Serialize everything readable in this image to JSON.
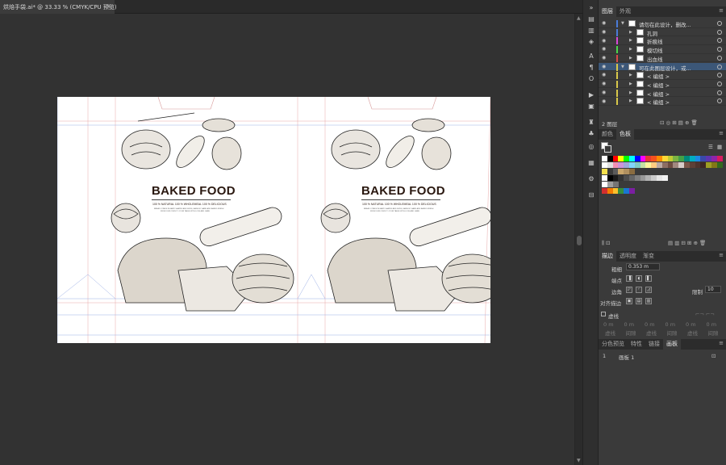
{
  "document_tab": {
    "title": "烘焙手袋.ai* @ 33.33 % (CMYK/CPU 预览)",
    "close_glyph": "×"
  },
  "artwork": {
    "left_panel": {
      "title": "BAKED FOOD",
      "subtitle": "100 % NATURAL  100 % WHOLEMEAL  100 % DELICIOUS",
      "fine_print_1": "BREAD COMES IN MANY SHAPES AND SIZES, MADE BY HAND AND BAKED FRESH",
      "fine_print_2": "FROM OUR OVEN TO YOUR TABLE WITH LOVE AND CARE"
    },
    "right_panel": {
      "title": "BAKED FOOD",
      "subtitle": "100 % NATURAL  100 % WHOLEMEAL  100 % DELICIOUS",
      "fine_print_1": "BREAD COMES IN MANY SHAPES AND SIZES, MADE BY HAND AND BAKED FRESH",
      "fine_print_2": "FROM OUR OVEN TO YOUR TABLE WITH LOVE AND CARE"
    }
  },
  "layers_panel": {
    "tabs": [
      "图层",
      "外观"
    ],
    "active_tab": "图层",
    "rows": [
      {
        "name": "请勿在此设计，删改...",
        "color": "#4a7bd8",
        "level": 0,
        "expanded": true,
        "selected": false
      },
      {
        "name": "孔洞",
        "color": "#4a7bd8",
        "level": 1,
        "expanded": false,
        "selected": false
      },
      {
        "name": "折痕线",
        "color": "#d84ad8",
        "level": 1,
        "expanded": false,
        "selected": false
      },
      {
        "name": "模切线",
        "color": "#4ad84a",
        "level": 1,
        "expanded": false,
        "selected": false
      },
      {
        "name": "出血线",
        "color": "#d84a4a",
        "level": 1,
        "expanded": false,
        "selected": false
      },
      {
        "name": "可在此图层设计，或...",
        "color": "#d8c84a",
        "level": 0,
        "expanded": true,
        "selected": true
      },
      {
        "name": "< 编组 >",
        "color": "#d8c84a",
        "level": 1,
        "expanded": false,
        "selected": false
      },
      {
        "name": "< 编组 >",
        "color": "#d8c84a",
        "level": 1,
        "expanded": false,
        "selected": false
      },
      {
        "name": "< 编组 >",
        "color": "#d8c84a",
        "level": 1,
        "expanded": false,
        "selected": false
      },
      {
        "name": "< 编组 >",
        "color": "#d8c84a",
        "level": 1,
        "expanded": false,
        "selected": false
      }
    ],
    "footer_label": "2 图层"
  },
  "color_panel": {
    "tabs": [
      "颜色",
      "色板"
    ],
    "active_tab": "色板"
  },
  "stroke_panel": {
    "tabs": [
      "描边",
      "透明度",
      "渐变"
    ],
    "active_tab": "描边",
    "weight_label": "粗细",
    "weight_value": "0.353 m",
    "cap_label": "端点",
    "corner_label": "边角",
    "miter_label": "限制",
    "miter_value": "10",
    "align_label": "对齐描边",
    "dashed_label": "虚线",
    "dash_fields": [
      "虚线",
      "间隙",
      "虚线",
      "间隙",
      "虚线",
      "间隙"
    ],
    "dash_unit": "0 m"
  },
  "artboards_panel": {
    "tabs": [
      "分色预览",
      "特性",
      "链接",
      "画板"
    ],
    "active_tab": "画板",
    "rows": [
      {
        "index": "1",
        "name": "画板 1"
      }
    ]
  },
  "toolstrip": {
    "icons": [
      "collapse-icon",
      "libraries-icon",
      "properties-icon",
      "layers-icon",
      "character-icon",
      "paragraph-icon",
      "opentype-icon",
      "actions-icon",
      "artboards-icon",
      "swatches-icon",
      "brushes-icon",
      "symbols-icon",
      "graphic-styles-icon",
      "image-trace-icon",
      "transform-icon",
      "align-icon"
    ]
  }
}
